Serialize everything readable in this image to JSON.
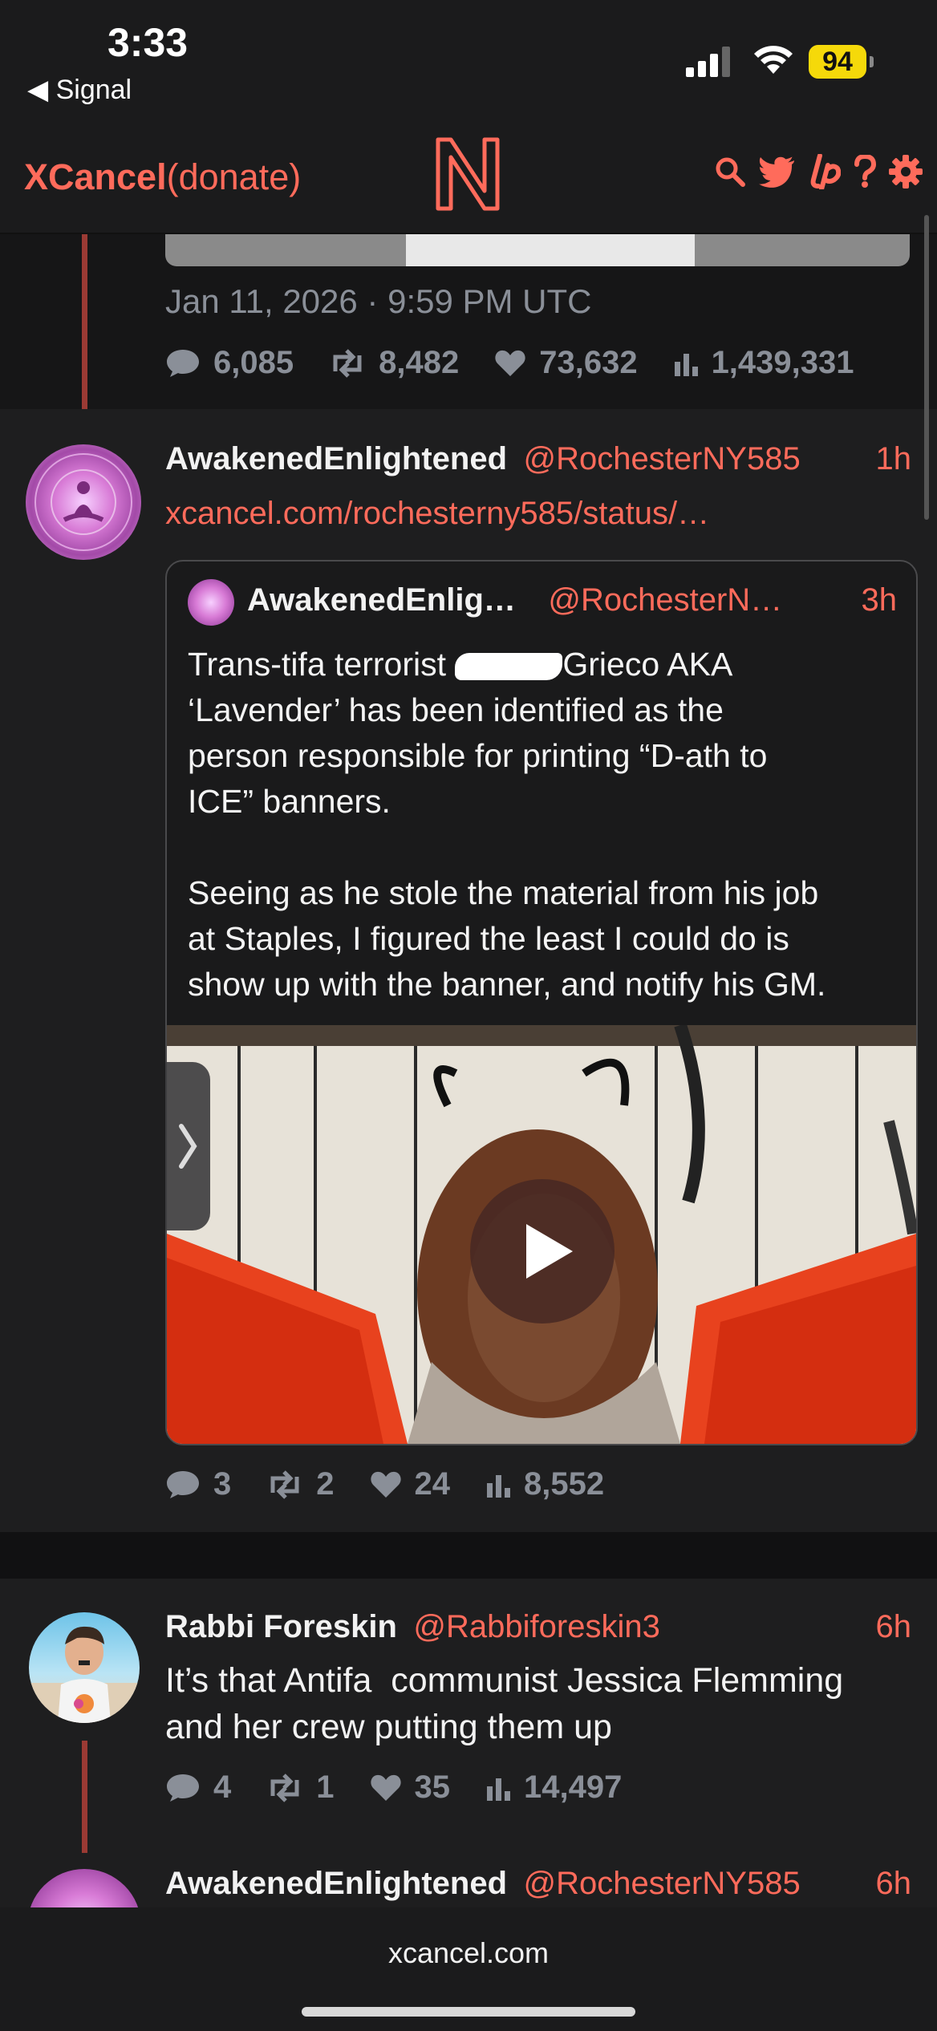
{
  "status_bar": {
    "time": "3:33",
    "back_app": "◀ Signal",
    "battery": "94"
  },
  "header": {
    "brand_bold": "XCancel",
    "brand_link": "(donate)"
  },
  "tweet1": {
    "date": "Jan 11, 2026 · 9:59 PM UTC",
    "stats": {
      "replies": "6,085",
      "retweets": "8,482",
      "likes": "73,632",
      "views": "1,439,331"
    }
  },
  "tweet2": {
    "name": "AwakenedEnlightened",
    "handle": "@RochesterNY585",
    "time": "1h",
    "link": "xcancel.com/rochesterny585/status/…",
    "quote": {
      "name": "AwakenedEnlig…",
      "handle": "@RochesterN…",
      "time": "3h",
      "text_line1_pre": "Trans-tifa terrorist ",
      "text_line1_post": "Grieco AKA",
      "text_rest": "‘Lavender’ has been identified as the\nperson responsible for printing “D-ath to\nICE” banners.\n\nSeeing as he stole the material from his job\nat Staples, I figured the least I could do is\nshow up with the banner, and notify his GM."
    },
    "stats": {
      "replies": "3",
      "retweets": "2",
      "likes": "24",
      "views": "8,552"
    }
  },
  "tweet3": {
    "name": "Rabbi Foreskin",
    "handle": "@Rabbiforeskin3",
    "time": "6h",
    "text": "It’s that Antifa  communist Jessica Flemming\nand her crew putting them up",
    "stats": {
      "replies": "4",
      "retweets": "1",
      "likes": "35",
      "views": "14,497"
    }
  },
  "tweet4": {
    "name": "AwakenedEnlightened",
    "handle": "@RochesterNY585",
    "time": "6h"
  },
  "bottom_bar": {
    "url": "xcancel.com"
  },
  "colors": {
    "accent": "#ff6b5b",
    "background": "#1e1e1f",
    "muted": "#8a8f98"
  }
}
